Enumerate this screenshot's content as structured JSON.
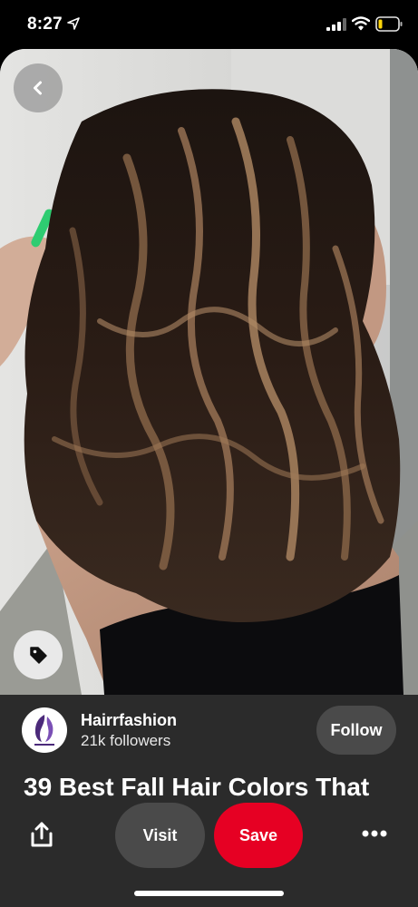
{
  "status_bar": {
    "time": "8:27"
  },
  "pin": {
    "image_alt": "Woman with dark brown wavy lob hair and caramel balayage highlights",
    "title": "39 Best Fall Hair Colors That"
  },
  "creator": {
    "name": "Hairrfashion",
    "followers": "21k followers",
    "follow_label": "Follow",
    "avatar_text": "Hairrfashion"
  },
  "actions": {
    "visit_label": "Visit",
    "save_label": "Save"
  },
  "icons": {
    "back": "chevron-left-icon",
    "tag": "tag-icon",
    "share": "share-icon",
    "more": "more-dots-icon"
  },
  "colors": {
    "save": "#e60023",
    "sheet": "#2b2b2b",
    "secondary_button": "#4a4a4a"
  }
}
